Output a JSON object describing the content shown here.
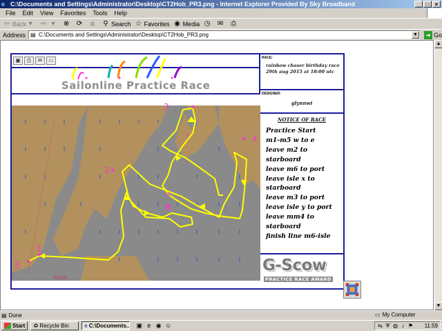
{
  "window": {
    "title": "C:\\Documents and Settings\\Administrator\\Desktop\\CT2Hob_PR3.png - Internet Explorer Provided By Sky Broadband",
    "controls": [
      "_",
      "□",
      "×"
    ]
  },
  "menu": [
    "File",
    "Edit",
    "View",
    "Favorites",
    "Tools",
    "Help"
  ],
  "toolbar": {
    "back": "Back",
    "search": "Search",
    "favorites": "Favorites",
    "media": "Media"
  },
  "address": {
    "label": "Address",
    "value": "C:\\Documents and Settings\\Administrator\\Desktop\\CT2Hob_PR3.png",
    "go": "Go"
  },
  "page": {
    "brand": "Sailonline Practice Race",
    "race_label": "RACE:",
    "race_name": "rainbow chaser birthday race",
    "race_date": "29th aug 2015 at 18:00 utc",
    "designer_label": "DESIGNER:",
    "designer": "glynnwi",
    "notice_title": "NOTICE OF RACE",
    "notice_lines": [
      "Practice Start",
      "m1-m5 w to e",
      "leave m2 to",
      "starboard",
      "leave m6 to port",
      "leave isle x to",
      "starboard",
      "leave m3 to port",
      "leave isle y to port",
      "leave mm4 to",
      "starboard",
      "finish line m6-isle"
    ],
    "logo_text": "G-Scow",
    "logo_sub": "PRACTICE RACE AWARD",
    "finish_label": "Finish",
    "mark_labels": [
      "1",
      "2",
      "3",
      "4",
      "5",
      "6",
      "X",
      "Y"
    ]
  },
  "status": {
    "text": "Done",
    "zone": "My Computer"
  },
  "taskbar": {
    "start": "Start",
    "items": [
      "Recycle Bin",
      "C:\\Documents..."
    ],
    "clock": "11:59"
  },
  "colors": {
    "land": "#b2915e",
    "rock": "#8a8a8a",
    "course": "#ffff00",
    "marks": "#ff33cc",
    "frame": "#1c1c9c"
  }
}
